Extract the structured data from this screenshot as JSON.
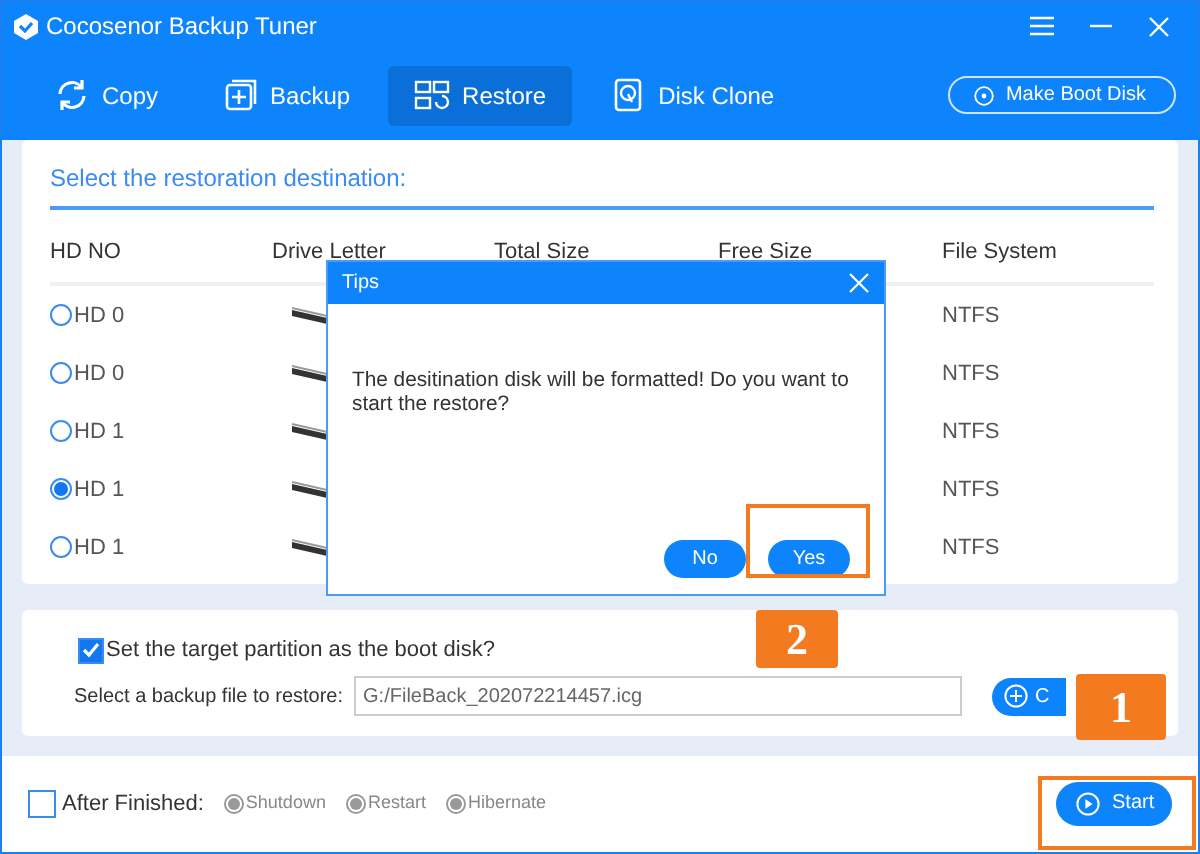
{
  "window": {
    "title": "Cocosenor Backup Tuner"
  },
  "nav": [
    {
      "label": "Copy",
      "kind": "copy",
      "selected": false
    },
    {
      "label": "Backup",
      "kind": "backup",
      "selected": false
    },
    {
      "label": "Restore",
      "kind": "restore",
      "selected": true
    },
    {
      "label": "Disk Clone",
      "kind": "clone",
      "selected": false
    }
  ],
  "boot_disk_button": "Make Boot Disk",
  "destination": {
    "heading": "Select the restoration destination:",
    "columns": [
      "HD NO",
      "Drive Letter",
      "Total Size",
      "Free Size",
      "File System"
    ],
    "rows": [
      {
        "hd": "HD 0",
        "file_system": "NTFS",
        "selected": false
      },
      {
        "hd": "HD 0",
        "file_system": "NTFS",
        "selected": false
      },
      {
        "hd": "HD 1",
        "file_system": "NTFS",
        "selected": false
      },
      {
        "hd": "HD 1",
        "file_system": "NTFS",
        "selected": true
      },
      {
        "hd": "HD 1",
        "file_system": "NTFS",
        "selected": false
      }
    ]
  },
  "options": {
    "boot_checkbox": {
      "label": "Set the target partition as the boot disk?",
      "checked": true
    },
    "file_label": "Select a backup file to restore:",
    "file_value": "G:/FileBack_202072214457.icg",
    "browse_button": "C"
  },
  "footer": {
    "after_finished": {
      "label": "After Finished:",
      "checked": false
    },
    "actions": [
      {
        "label": "Shutdown",
        "disabled": true
      },
      {
        "label": "Restart",
        "disabled": true
      },
      {
        "label": "Hibernate",
        "disabled": true
      }
    ],
    "start_button": "Start"
  },
  "dialog": {
    "title": "Tips",
    "message": "The desitination disk will be formatted! Do you want to start the restore?",
    "buttons": [
      "No",
      "Yes"
    ]
  },
  "callouts": [
    "2",
    "1"
  ]
}
